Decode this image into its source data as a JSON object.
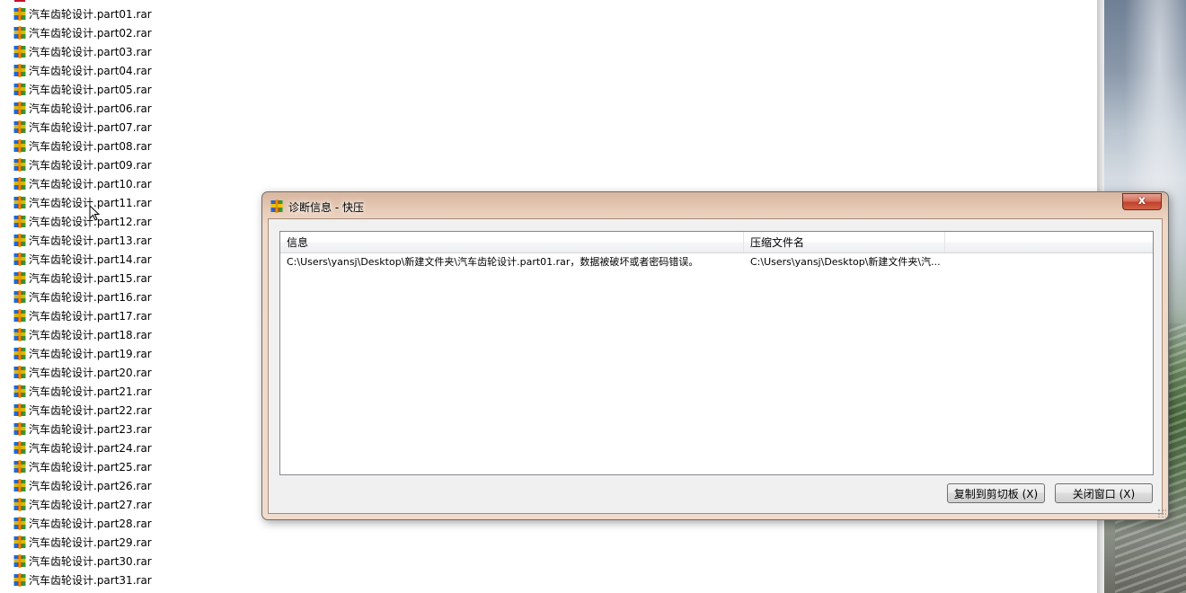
{
  "explorer": {
    "files": [
      "汽车齿轮设计.part01.rar",
      "汽车齿轮设计.part02.rar",
      "汽车齿轮设计.part03.rar",
      "汽车齿轮设计.part04.rar",
      "汽车齿轮设计.part05.rar",
      "汽车齿轮设计.part06.rar",
      "汽车齿轮设计.part07.rar",
      "汽车齿轮设计.part08.rar",
      "汽车齿轮设计.part09.rar",
      "汽车齿轮设计.part10.rar",
      "汽车齿轮设计.part11.rar",
      "汽车齿轮设计.part12.rar",
      "汽车齿轮设计.part13.rar",
      "汽车齿轮设计.part14.rar",
      "汽车齿轮设计.part15.rar",
      "汽车齿轮设计.part16.rar",
      "汽车齿轮设计.part17.rar",
      "汽车齿轮设计.part18.rar",
      "汽车齿轮设计.part19.rar",
      "汽车齿轮设计.part20.rar",
      "汽车齿轮设计.part21.rar",
      "汽车齿轮设计.part22.rar",
      "汽车齿轮设计.part23.rar",
      "汽车齿轮设计.part24.rar",
      "汽车齿轮设计.part25.rar",
      "汽车齿轮设计.part26.rar",
      "汽车齿轮设计.part27.rar",
      "汽车齿轮设计.part28.rar",
      "汽车齿轮设计.part29.rar",
      "汽车齿轮设计.part30.rar",
      "汽车齿轮设计.part31.rar"
    ],
    "icon": "rar-archive-icon"
  },
  "dialog": {
    "title": "诊断信息 - 快压",
    "close_label": "x",
    "columns": [
      "信息",
      "压缩文件名"
    ],
    "rows": [
      {
        "info": "C:\\Users\\yansj\\Desktop\\新建文件夹\\汽车齿轮设计.part01.rar，数据被破坏或者密码错误。",
        "archive": "C:\\Users\\yansj\\Desktop\\新建文件夹\\汽..."
      }
    ],
    "copy_button": "复制到剪切板 (X)",
    "close_button": "关闭窗口 (X)"
  },
  "colors": {
    "dialog_frame": "#efd9c7",
    "close_button": "#c2412a",
    "list_border": "#828790"
  }
}
